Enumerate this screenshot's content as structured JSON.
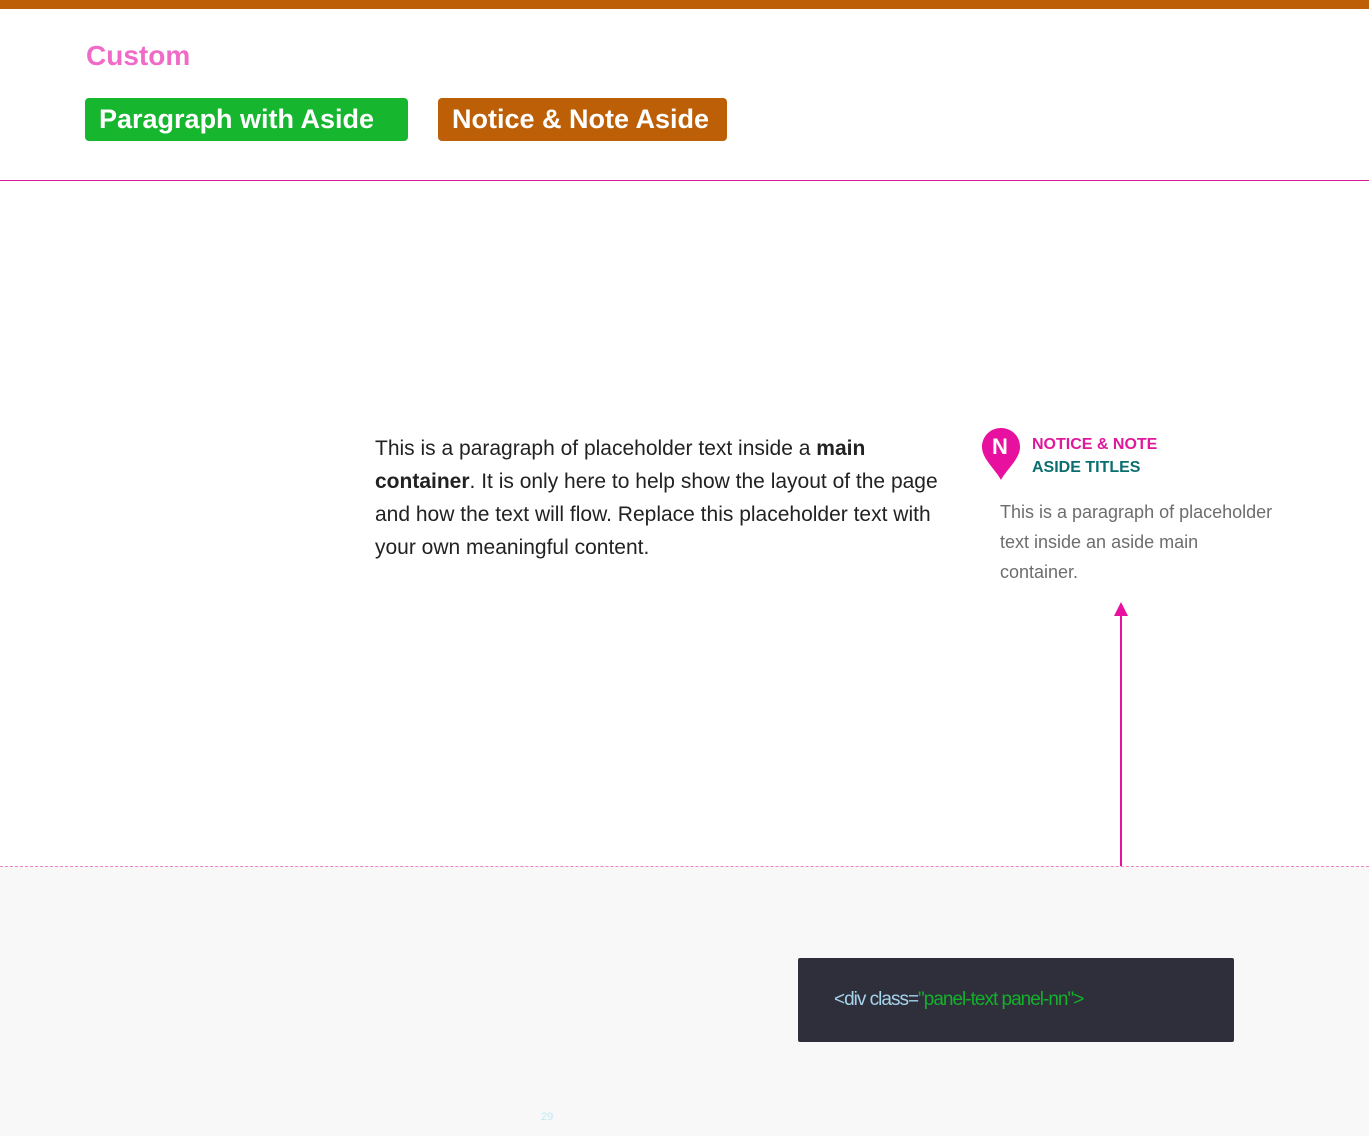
{
  "header": {
    "section_title": "Custom",
    "tags": [
      {
        "label": "Paragraph with Aside",
        "color": "#16b62e"
      },
      {
        "label": "Notice & Note Aside",
        "color": "#bd5f06"
      }
    ]
  },
  "main": {
    "paragraph_before": "This is a paragraph of placeholder text inside a ",
    "paragraph_bold": "main container",
    "paragraph_after": ". It is only here to help show the layout of the page and how the text will flow. Replace this placeholder text with your own meaningful content."
  },
  "aside": {
    "icon": "map-pin-n-icon",
    "icon_letter": "N",
    "title_line1": "NOTICE & NOTE",
    "title_line2": "ASIDE TITLES",
    "paragraph": "This is a paragraph of placeholder text inside an aside main container."
  },
  "code": {
    "tag_part": "<div class=",
    "value_part": "\"panel-text panel-nn\">"
  },
  "footer": {
    "page_number": "29"
  },
  "colors": {
    "accent_orange": "#bd5f06",
    "accent_green": "#16b62e",
    "accent_pink": "#f06bc8",
    "magenta": "#e0189b",
    "teal": "#0b6e6e",
    "code_bg": "#2e2f3b"
  }
}
